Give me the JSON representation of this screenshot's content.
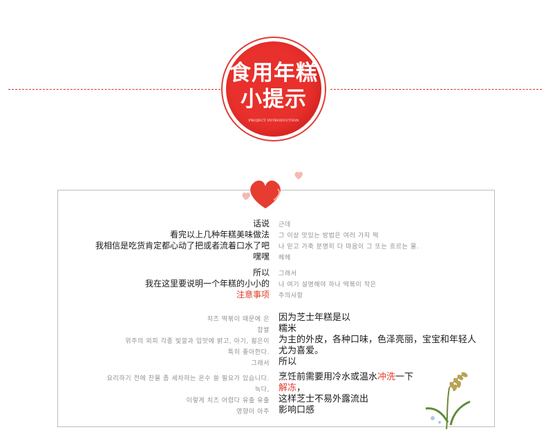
{
  "badge": {
    "line1": "食用年糕",
    "line2": "小提示",
    "subtitle": "PROJECT INTRODUCTION"
  },
  "block1": {
    "cn": [
      "话说",
      "看完以上几种年糕美味做法",
      "我相信是吃货肯定都心动了把或者流着口水了吧",
      "嘿嘿"
    ],
    "ko": [
      "근데",
      "그 이상 맛있는 방법은 여러 가지 떡",
      "나 믿고 가축 분명히 다 마음이 그 또는 흐르는 물.",
      "헤헤"
    ]
  },
  "block2": {
    "cn": [
      "所以",
      "我在这里要说明一个年糕的小小的"
    ],
    "cn_red": "注意事项",
    "ko": [
      "그래서",
      "나 여기 설명해야 하나 떡볶이 작은",
      "주의사항"
    ]
  },
  "block3": {
    "ko": [
      "치즈 떡볶이 때문에 은",
      "찹쌀",
      "위주의 외피 각종 빛깔과 입맛에 밝고, 아기, 젊은이",
      "특히 좋아한다.",
      "그래서"
    ],
    "cn": [
      "因为芝士年糕是以",
      "糯米",
      "为主的外皮，各种口味，色泽亮丽，宝宝和年轻人",
      "尤为喜爱。",
      "所以"
    ]
  },
  "block4": {
    "ko": [
      "요리하기 전에 찬물 좀 세차하는 온수 쓸 필요가 있습니다.",
      "녹다,",
      "이렇게 치즈 어렵다 유출 유출",
      "영향이 아주"
    ],
    "cn_line1_a": "烹饪前需要用冷水或温水",
    "cn_line1_red": "冲洗",
    "cn_line1_b": "一下",
    "cn_line2_red": "解冻",
    "cn_line2_b": "，",
    "cn_line3": "这样芝士不易外露流出",
    "cn_line4": "影响口感"
  },
  "colors": {
    "accent": "#e8302c",
    "dash": "#d9312e",
    "border": "#bdbdbd"
  }
}
